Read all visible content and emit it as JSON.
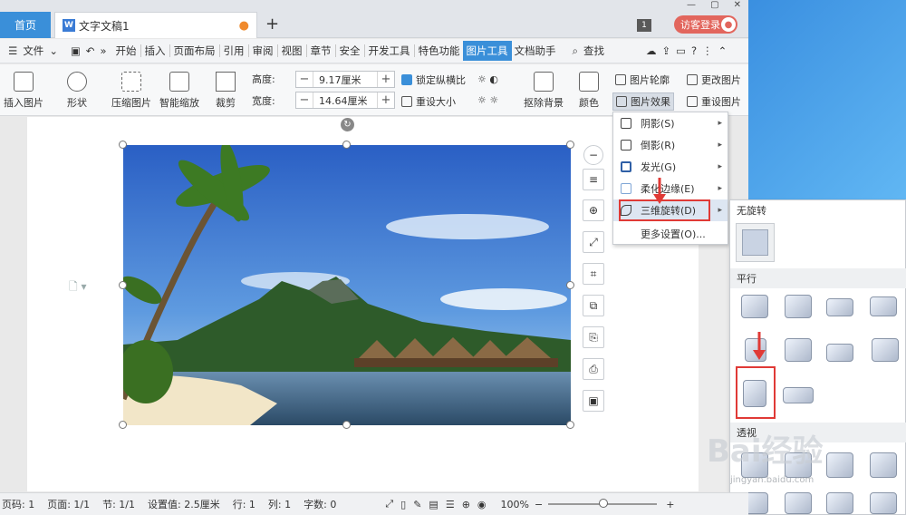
{
  "titlebar": {
    "home_tab": "首页",
    "doc_tab": "文字文稿1",
    "doc_modified": "●",
    "add_tab": "+",
    "page_badge": "1",
    "login": "访客登录",
    "window_controls": [
      "—",
      "▢",
      "✕"
    ]
  },
  "menubar": {
    "file": "文件",
    "items": [
      "开始",
      "插入",
      "页面布局",
      "引用",
      "审阅",
      "视图",
      "章节",
      "安全",
      "开发工具",
      "特色功能",
      "图片工具",
      "文档助手"
    ],
    "active": "图片工具",
    "search": "查找"
  },
  "ribbon": {
    "insert_picture": "插入图片",
    "shape": "形状",
    "compress": "压缩图片",
    "smart_zoom": "智能缩放",
    "crop": "裁剪",
    "height_label": "高度:",
    "height_value": "9.17厘米",
    "width_label": "宽度:",
    "width_value": "14.64厘米",
    "lock_ratio": "锁定纵横比",
    "reset_size": "重设大小",
    "remove_bg": "抠除背景",
    "color": "颜色",
    "outline": "图片轮廓",
    "effects": "图片效果",
    "change_pic": "更改图片",
    "reset_pic": "重设图片"
  },
  "effects_menu": {
    "items": [
      {
        "label": "阴影(S)"
      },
      {
        "label": "倒影(R)"
      },
      {
        "label": "发光(G)"
      },
      {
        "label": "柔化边缘(E)"
      },
      {
        "label": "三维旋转(D)"
      },
      {
        "label": "更多设置(O)..."
      }
    ]
  },
  "rotation_submenu": {
    "no_rotation": "无旋转",
    "parallel": "平行",
    "perspective": "透视"
  },
  "statusbar": {
    "page_code": "页码: 1",
    "pages": "页面: 1/1",
    "section": "节: 1/1",
    "setting": "设置值: 2.5厘米",
    "row": "行: 1",
    "col": "列: 1",
    "chars": "字数: 0",
    "zoom": "100%"
  },
  "watermark": {
    "text": "Bai经验",
    "url": "jingyan.baidu.com"
  },
  "colors": {
    "accent": "#3a8fd9",
    "login": "#e2665d",
    "highlight": "#e03a36"
  }
}
